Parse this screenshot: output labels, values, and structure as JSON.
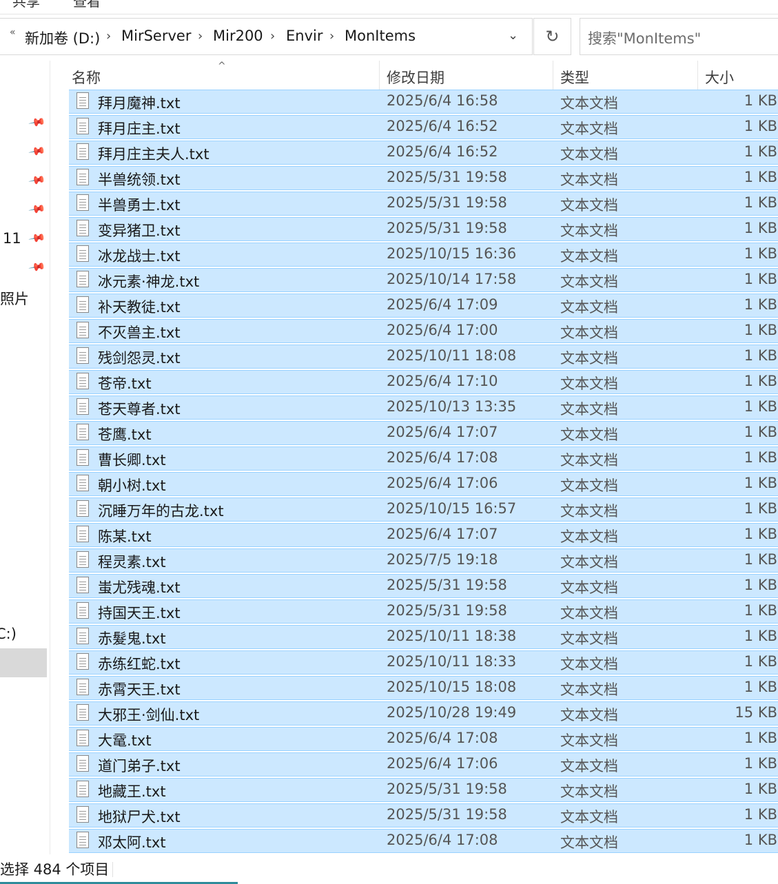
{
  "ribbon": {
    "tab_share": "共享",
    "tab_view": "查看"
  },
  "address": {
    "prev_icon": "«",
    "crumbs": [
      "新加卷 (D:)",
      "MirServer",
      "Mir200",
      "Envir",
      "MonItems"
    ],
    "sep": "›",
    "dropdown": "⌄",
    "refresh": "↻"
  },
  "search": {
    "placeholder": "搜索\"MonItems\""
  },
  "nav": {
    "item_11": "11",
    "item_photos": "照片",
    "item_c": "C:)"
  },
  "columns": {
    "name": "名称",
    "date": "修改日期",
    "type": "类型",
    "size": "大小",
    "sort_indicator": "^"
  },
  "files": [
    {
      "name": "拜月魔神.txt",
      "date": "2025/6/4 16:58",
      "type": "文本文档",
      "size": "1 KB"
    },
    {
      "name": "拜月庄主.txt",
      "date": "2025/6/4 16:52",
      "type": "文本文档",
      "size": "1 KB"
    },
    {
      "name": "拜月庄主夫人.txt",
      "date": "2025/6/4 16:52",
      "type": "文本文档",
      "size": "1 KB"
    },
    {
      "name": "半兽统领.txt",
      "date": "2025/5/31 19:58",
      "type": "文本文档",
      "size": "1 KB"
    },
    {
      "name": "半兽勇士.txt",
      "date": "2025/5/31 19:58",
      "type": "文本文档",
      "size": "1 KB"
    },
    {
      "name": "变异猪卫.txt",
      "date": "2025/5/31 19:58",
      "type": "文本文档",
      "size": "1 KB"
    },
    {
      "name": "冰龙战士.txt",
      "date": "2025/10/15 16:36",
      "type": "文本文档",
      "size": "1 KB"
    },
    {
      "name": "冰元素·神龙.txt",
      "date": "2025/10/14 17:58",
      "type": "文本文档",
      "size": "1 KB"
    },
    {
      "name": "补天教徒.txt",
      "date": "2025/6/4 17:09",
      "type": "文本文档",
      "size": "1 KB"
    },
    {
      "name": "不灭兽主.txt",
      "date": "2025/6/4 17:00",
      "type": "文本文档",
      "size": "1 KB"
    },
    {
      "name": "残剑怨灵.txt",
      "date": "2025/10/11 18:08",
      "type": "文本文档",
      "size": "1 KB"
    },
    {
      "name": "苍帝.txt",
      "date": "2025/6/4 17:10",
      "type": "文本文档",
      "size": "1 KB"
    },
    {
      "name": "苍天尊者.txt",
      "date": "2025/10/13 13:35",
      "type": "文本文档",
      "size": "1 KB"
    },
    {
      "name": "苍鹰.txt",
      "date": "2025/6/4 17:07",
      "type": "文本文档",
      "size": "1 KB"
    },
    {
      "name": "曹长卿.txt",
      "date": "2025/6/4 17:08",
      "type": "文本文档",
      "size": "1 KB"
    },
    {
      "name": "朝小树.txt",
      "date": "2025/6/4 17:06",
      "type": "文本文档",
      "size": "1 KB"
    },
    {
      "name": "沉睡万年的古龙.txt",
      "date": "2025/10/15 16:57",
      "type": "文本文档",
      "size": "1 KB"
    },
    {
      "name": "陈某.txt",
      "date": "2025/6/4 17:07",
      "type": "文本文档",
      "size": "1 KB"
    },
    {
      "name": "程灵素.txt",
      "date": "2025/7/5 19:18",
      "type": "文本文档",
      "size": "1 KB"
    },
    {
      "name": "蚩尤残魂.txt",
      "date": "2025/5/31 19:58",
      "type": "文本文档",
      "size": "1 KB"
    },
    {
      "name": "持国天王.txt",
      "date": "2025/5/31 19:58",
      "type": "文本文档",
      "size": "1 KB"
    },
    {
      "name": "赤髮鬼.txt",
      "date": "2025/10/11 18:38",
      "type": "文本文档",
      "size": "1 KB"
    },
    {
      "name": "赤练红蛇.txt",
      "date": "2025/10/11 18:33",
      "type": "文本文档",
      "size": "1 KB"
    },
    {
      "name": "赤霄天王.txt",
      "date": "2025/10/15 18:08",
      "type": "文本文档",
      "size": "1 KB"
    },
    {
      "name": "大邪王·剑仙.txt",
      "date": "2025/10/28 19:49",
      "type": "文本文档",
      "size": "15 KB"
    },
    {
      "name": "大鼋.txt",
      "date": "2025/6/4 17:08",
      "type": "文本文档",
      "size": "1 KB"
    },
    {
      "name": "道门弟子.txt",
      "date": "2025/6/4 17:06",
      "type": "文本文档",
      "size": "1 KB"
    },
    {
      "name": "地藏王.txt",
      "date": "2025/5/31 19:58",
      "type": "文本文档",
      "size": "1 KB"
    },
    {
      "name": "地狱尸犬.txt",
      "date": "2025/5/31 19:58",
      "type": "文本文档",
      "size": "1 KB"
    },
    {
      "name": "邓太阿.txt",
      "date": "2025/6/4 17:08",
      "type": "文本文档",
      "size": "1 KB"
    }
  ],
  "status": {
    "text": "选择 484 个项目"
  },
  "colors": {
    "selection_bg": "#cce8ff",
    "selection_border": "#99d1ff",
    "accent": "#2e8b9a"
  }
}
